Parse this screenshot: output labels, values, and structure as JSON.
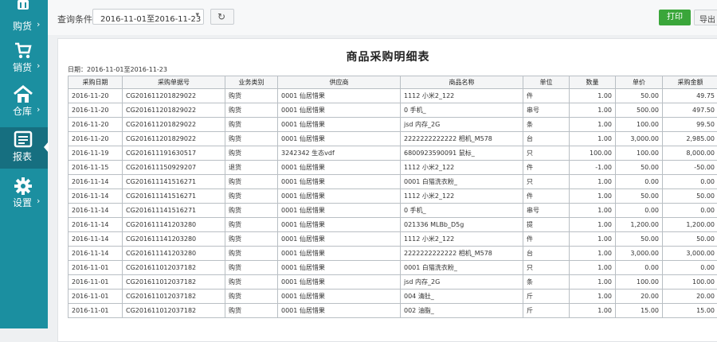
{
  "sidebar": {
    "items": [
      {
        "label": "购货",
        "icon": "basket-icon",
        "chevron": "›"
      },
      {
        "label": "销货",
        "icon": "cart-icon",
        "chevron": "›"
      },
      {
        "label": "仓库",
        "icon": "warehouse-icon",
        "chevron": "›"
      },
      {
        "label": "报表",
        "icon": "report-icon",
        "chevron": ""
      },
      {
        "label": "设置",
        "icon": "gear-icon",
        "chevron": "›"
      }
    ],
    "active_index": 3,
    "bg_color": "#1b8fa0",
    "active_color": "#166f80"
  },
  "toolbar": {
    "query_label": "查询条件",
    "date_range_value": "2016-11-01至2016-11-23",
    "print_label": "打印",
    "export_label": "导出",
    "print_color": "#3aa63a"
  },
  "report": {
    "title": "商品采购明细表",
    "date_line": "日期：2016-11-01至2016-11-23",
    "columns": [
      "采购日期",
      "采购单据号",
      "业务类别",
      "供应商",
      "商品名称",
      "单位",
      "数量",
      "单价",
      "采购金额"
    ],
    "rows": [
      [
        "2016-11-20",
        "CG201611201829022",
        "购货",
        "0001 仙居惜果",
        "1112 小米2_122",
        "件",
        "1.00",
        "50.00",
        "49.75"
      ],
      [
        "2016-11-20",
        "CG201611201829022",
        "购货",
        "0001 仙居惜果",
        "0 手机_",
        "串号",
        "1.00",
        "500.00",
        "497.50"
      ],
      [
        "2016-11-20",
        "CG201611201829022",
        "购货",
        "0001 仙居惜果",
        "jsd 内存_2G",
        "条",
        "1.00",
        "100.00",
        "99.50"
      ],
      [
        "2016-11-20",
        "CG201611201829022",
        "购货",
        "0001 仙居惜果",
        "2222222222222 相机_M578",
        "台",
        "1.00",
        "3,000.00",
        "2,985.00"
      ],
      [
        "2016-11-19",
        "CG201611191630517",
        "购货",
        "3242342 生态vdf",
        "6800923590091 鼠标_",
        "只",
        "100.00",
        "100.00",
        "8,000.00"
      ],
      [
        "2016-11-15",
        "CG201611150929207",
        "退货",
        "0001 仙居惜果",
        "1112 小米2_122",
        "件",
        "-1.00",
        "50.00",
        "-50.00"
      ],
      [
        "2016-11-14",
        "CG201611141516271",
        "购货",
        "0001 仙居惜果",
        "0001 白猫洗衣粉_",
        "只",
        "1.00",
        "0.00",
        "0.00"
      ],
      [
        "2016-11-14",
        "CG201611141516271",
        "购货",
        "0001 仙居惜果",
        "1112 小米2_122",
        "件",
        "1.00",
        "50.00",
        "50.00"
      ],
      [
        "2016-11-14",
        "CG201611141516271",
        "购货",
        "0001 仙居惜果",
        "0 手机_",
        "串号",
        "1.00",
        "0.00",
        "0.00"
      ],
      [
        "2016-11-14",
        "CG201611141203280",
        "购货",
        "0001 仙居惜果",
        "021336 MLBb_D5g",
        "提",
        "1.00",
        "1,200.00",
        "1,200.00"
      ],
      [
        "2016-11-14",
        "CG201611141203280",
        "购货",
        "0001 仙居惜果",
        "1112 小米2_122",
        "件",
        "1.00",
        "50.00",
        "50.00"
      ],
      [
        "2016-11-14",
        "CG201611141203280",
        "购货",
        "0001 仙居惜果",
        "2222222222222 相机_M578",
        "台",
        "1.00",
        "3,000.00",
        "3,000.00"
      ],
      [
        "2016-11-01",
        "CG201611012037182",
        "购货",
        "0001 仙居惜果",
        "0001 白猫洗衣粉_",
        "只",
        "1.00",
        "0.00",
        "0.00"
      ],
      [
        "2016-11-01",
        "CG201611012037182",
        "购货",
        "0001 仙居惜果",
        "jsd 内存_2G",
        "条",
        "1.00",
        "100.00",
        "100.00"
      ],
      [
        "2016-11-01",
        "CG201611012037182",
        "购货",
        "0001 仙居惜果",
        "004 清肚_",
        "斤",
        "1.00",
        "20.00",
        "20.00"
      ],
      [
        "2016-11-01",
        "CG201611012037182",
        "购货",
        "0001 仙居惜果",
        "002 油脂_",
        "斤",
        "1.00",
        "15.00",
        "15.00"
      ]
    ]
  }
}
